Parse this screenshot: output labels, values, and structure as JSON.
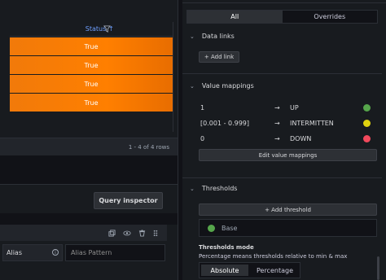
{
  "table": {
    "column_header": "Status",
    "sort_arrow": "↑",
    "filter_icon": "filter-icon",
    "rows": [
      "True",
      "True",
      "True",
      "True"
    ],
    "row_color": "#ff7f00",
    "pager_text": "1 - 4 of 4 rows"
  },
  "query": {
    "inspector_label": "Query inspector",
    "alias_label": "Alias",
    "alias_placeholder": "Alias Pattern"
  },
  "tabs": {
    "all": "All",
    "overrides": "Overrides"
  },
  "data_links": {
    "title": "Data links",
    "add_label": "+ Add link"
  },
  "value_mappings": {
    "title": "Value mappings",
    "items": [
      {
        "value": "1",
        "arrow": "→",
        "text": "UP",
        "color": "#56a64b"
      },
      {
        "value": "[0.001 - 0.999]",
        "arrow": "→",
        "text": "INTERMITTEN",
        "color": "#e0d20f"
      },
      {
        "value": "0",
        "arrow": "→",
        "text": "DOWN",
        "color": "#f2495c"
      }
    ],
    "edit_label": "Edit value mappings"
  },
  "thresholds": {
    "title": "Thresholds",
    "add_label": "+ Add threshold",
    "base_label": "Base",
    "base_color": "#56a64b",
    "mode_title": "Thresholds mode",
    "mode_desc": "Percentage means thresholds relative to min & max",
    "mode_absolute": "Absolute",
    "mode_percentage": "Percentage"
  }
}
